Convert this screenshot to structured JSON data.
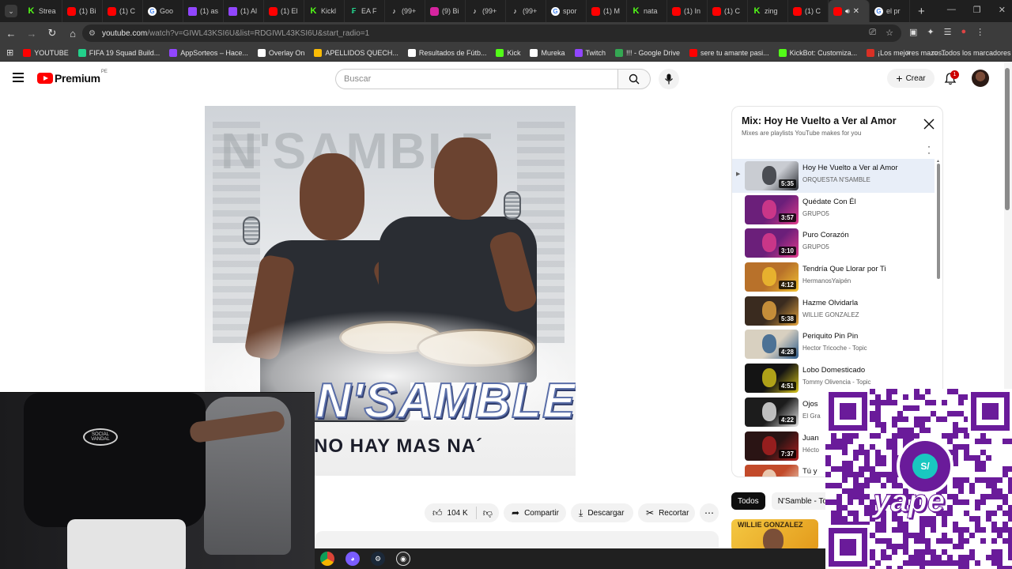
{
  "browser": {
    "tabs": [
      {
        "label": "Strea",
        "icon": "kick"
      },
      {
        "label": "(1) Bi",
        "icon": "youtube"
      },
      {
        "label": "(1) C",
        "icon": "youtube"
      },
      {
        "label": "Goo",
        "icon": "google"
      },
      {
        "label": "(1) as",
        "icon": "twitch"
      },
      {
        "label": "(1) Al",
        "icon": "twitch"
      },
      {
        "label": "(1) El",
        "icon": "youtube"
      },
      {
        "label": "Kickl",
        "icon": "kick"
      },
      {
        "label": "EA F",
        "icon": "ea-fc"
      },
      {
        "label": "(99+",
        "icon": "tiktok"
      },
      {
        "label": "(9) Bi",
        "icon": "instagram"
      },
      {
        "label": "(99+",
        "icon": "tiktok"
      },
      {
        "label": "(99+",
        "icon": "tiktok"
      },
      {
        "label": "spor",
        "icon": "google"
      },
      {
        "label": "(1) M",
        "icon": "youtube"
      },
      {
        "label": "nata",
        "icon": "kick"
      },
      {
        "label": "(1) In",
        "icon": "youtube"
      },
      {
        "label": "(1) C",
        "icon": "youtube"
      },
      {
        "label": "zing",
        "icon": "kick"
      },
      {
        "label": "(1) C",
        "icon": "youtube"
      },
      {
        "label": "el pr",
        "icon": "google"
      }
    ],
    "url_main": "youtube.com",
    "url_rest": "/watch?v=GIWL43KSI6U&list=RDGIWL43KSI6U&start_radio=1",
    "bookmarks": [
      {
        "label": "YOUTUBE",
        "color": "#ff0000"
      },
      {
        "label": "FIFA 19 Squad Build...",
        "color": "#23d18b"
      },
      {
        "label": "AppSorteos – Hace...",
        "color": "#9146ff"
      },
      {
        "label": "Overlay On",
        "color": "#ffffff"
      },
      {
        "label": "APELLIDOS QUECH...",
        "color": "#fbbc05"
      },
      {
        "label": "Resultados de Fútb...",
        "color": "#ffffff"
      },
      {
        "label": "Kick",
        "color": "#53fc18"
      },
      {
        "label": "Mureka",
        "color": "#ffffff"
      },
      {
        "label": "Twitch",
        "color": "#9146ff"
      },
      {
        "label": "!!! - Google Drive",
        "color": "#34a853"
      },
      {
        "label": "sere tu amante pasi...",
        "color": "#ff0000"
      },
      {
        "label": "KickBot: Customiza...",
        "color": "#53fc18"
      },
      {
        "label": "¡Los mejores mazos...",
        "color": "#d93025"
      }
    ],
    "all_bookmarks": "Todos los marcadores"
  },
  "youtube": {
    "logo_word": "Premium",
    "country": "PE",
    "search_placeholder": "Buscar",
    "create_label": "Crear",
    "notification_count": "1",
    "video_art": {
      "band": "N'SAMBLE",
      "subtitle": "NO HAY MAS NA´"
    },
    "actions": {
      "likes": "104 K",
      "share": "Compartir",
      "download": "Descargar",
      "clip": "Recortar"
    },
    "playlist": {
      "title": "Mix: Hoy He Vuelto a Ver al Amor",
      "subtitle": "Mixes are playlists YouTube makes for you",
      "items": [
        {
          "title": "Hoy He Vuelto a Ver al Amor",
          "artist": "ORQUESTA N'SAMBLE",
          "duration": "5:35",
          "active": true,
          "bg": "#c9ccd2",
          "accent": "#2a2d33"
        },
        {
          "title": "Quédate Con Él",
          "artist": "GRUPO5",
          "duration": "3:57",
          "active": false,
          "bg": "#6b1f7a",
          "accent": "#e13c8c"
        },
        {
          "title": "Puro Corazón",
          "artist": "GRUPO5",
          "duration": "3:10",
          "active": false,
          "bg": "#6b1f7a",
          "accent": "#e13c8c"
        },
        {
          "title": "Tendría Que Llorar por Ti",
          "artist": "HermanosYaipén",
          "duration": "4:12",
          "active": false,
          "bg": "#b8712a",
          "accent": "#f2c230"
        },
        {
          "title": "Hazme Olvidarla",
          "artist": "WILLIE GONZALEZ",
          "duration": "5:38",
          "active": false,
          "bg": "#3a2b1f",
          "accent": "#e7a640"
        },
        {
          "title": "Periquito Pin Pin",
          "artist": "Hector Tricoche - Topic",
          "duration": "4:28",
          "active": false,
          "bg": "#d8d0c0",
          "accent": "#2b5a8a"
        },
        {
          "title": "Lobo Domesticado",
          "artist": "Tommy Olivencia - Topic",
          "duration": "4:51",
          "active": false,
          "bg": "#141414",
          "accent": "#d6c419"
        },
        {
          "title": "Ojos",
          "artist": "El Gra",
          "duration": "4:22",
          "active": false,
          "bg": "#1c1c1c",
          "accent": "#e8e8e8"
        },
        {
          "title": "Juan",
          "artist": "Hécto",
          "duration": "7:37",
          "active": false,
          "bg": "#2a1414",
          "accent": "#b02020"
        },
        {
          "title": "Tú y",
          "artist": "",
          "duration": "",
          "active": false,
          "bg": "#c24a2a",
          "accent": "#f2e6d0"
        }
      ]
    },
    "chips": [
      {
        "label": "Todos",
        "selected": true
      },
      {
        "label": "N'Samble - To",
        "selected": false
      }
    ],
    "rec_thumb_text": "WILLIE GONZALEZ"
  },
  "overlay": {
    "shirt_logo": "SOCIAL VANDAL",
    "qr_brand": "yape",
    "qr_symbol": "S/"
  }
}
